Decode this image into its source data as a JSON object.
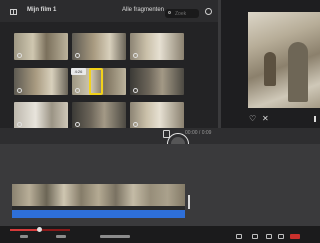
{
  "browser": {
    "event_title": "Mijn film 1",
    "filter_label": "Alle fragmenten",
    "search_placeholder": "Zoek",
    "tooltip": "4:26"
  },
  "viewer": {
    "time_current": "00:00",
    "time_separator": "/",
    "time_total": "0:09"
  },
  "icons": [
    "sidebar-toggle-icon",
    "search-icon",
    "clock-icon",
    "heart-icon",
    "reject-icon",
    "clip-icon",
    "edit-icon"
  ],
  "colors": {
    "accent_selection": "#f2d21b",
    "audio_track": "#2e6fd8",
    "scrub_fill": "#d63a3a"
  }
}
